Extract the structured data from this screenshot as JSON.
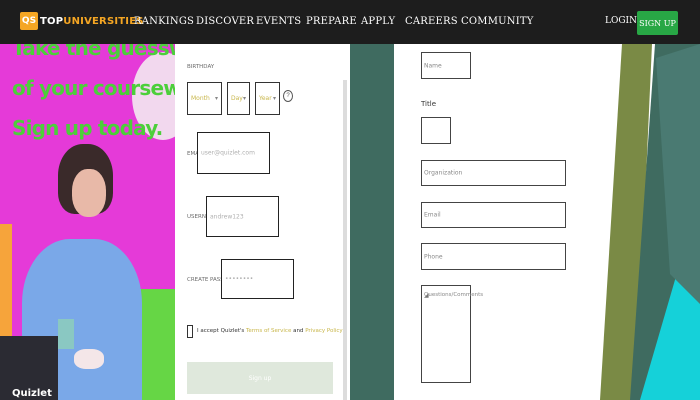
{
  "header": {
    "logo_mark": "QS",
    "logo_brand_primary": "TOP",
    "logo_brand_secondary": "UNIVERSITIES",
    "nav": [
      "RANKINGS",
      "DISCOVER",
      "EVENTS",
      "PREPARE",
      "APPLY",
      "CAREERS",
      "COMMUNITY"
    ],
    "login": "LOGIN",
    "signup": "SIGN UP"
  },
  "promo": {
    "lines": [
      "Take the guesswork out",
      "of your coursework.",
      "Sign up today."
    ],
    "brand": "Quizlet",
    "colors": {
      "background": "#e53ad8",
      "headline": "#4ccf3a"
    }
  },
  "signup_form": {
    "birthday_label": "BIRTHDAY",
    "month": "Month",
    "day": "Day",
    "year": "Year",
    "email_label": "EMAIL",
    "email_placeholder": "user@quizlet.com",
    "username_label": "USERNAME",
    "username_placeholder": "andrew123",
    "password_label": "CREATE PASSWORD",
    "password_placeholder": "••••••••",
    "terms_prefix": "I accept Quizlet's",
    "terms_link": "Terms of Service",
    "terms_and": "and",
    "privacy_link": "Privacy Policy",
    "submit": "Sign up"
  },
  "contact_form": {
    "name_placeholder": "Name",
    "title_label": "Title",
    "organization_placeholder": "Organization",
    "email_placeholder": "Email",
    "phone_placeholder": "Phone",
    "comments_placeholder": "Questions/Comments"
  }
}
